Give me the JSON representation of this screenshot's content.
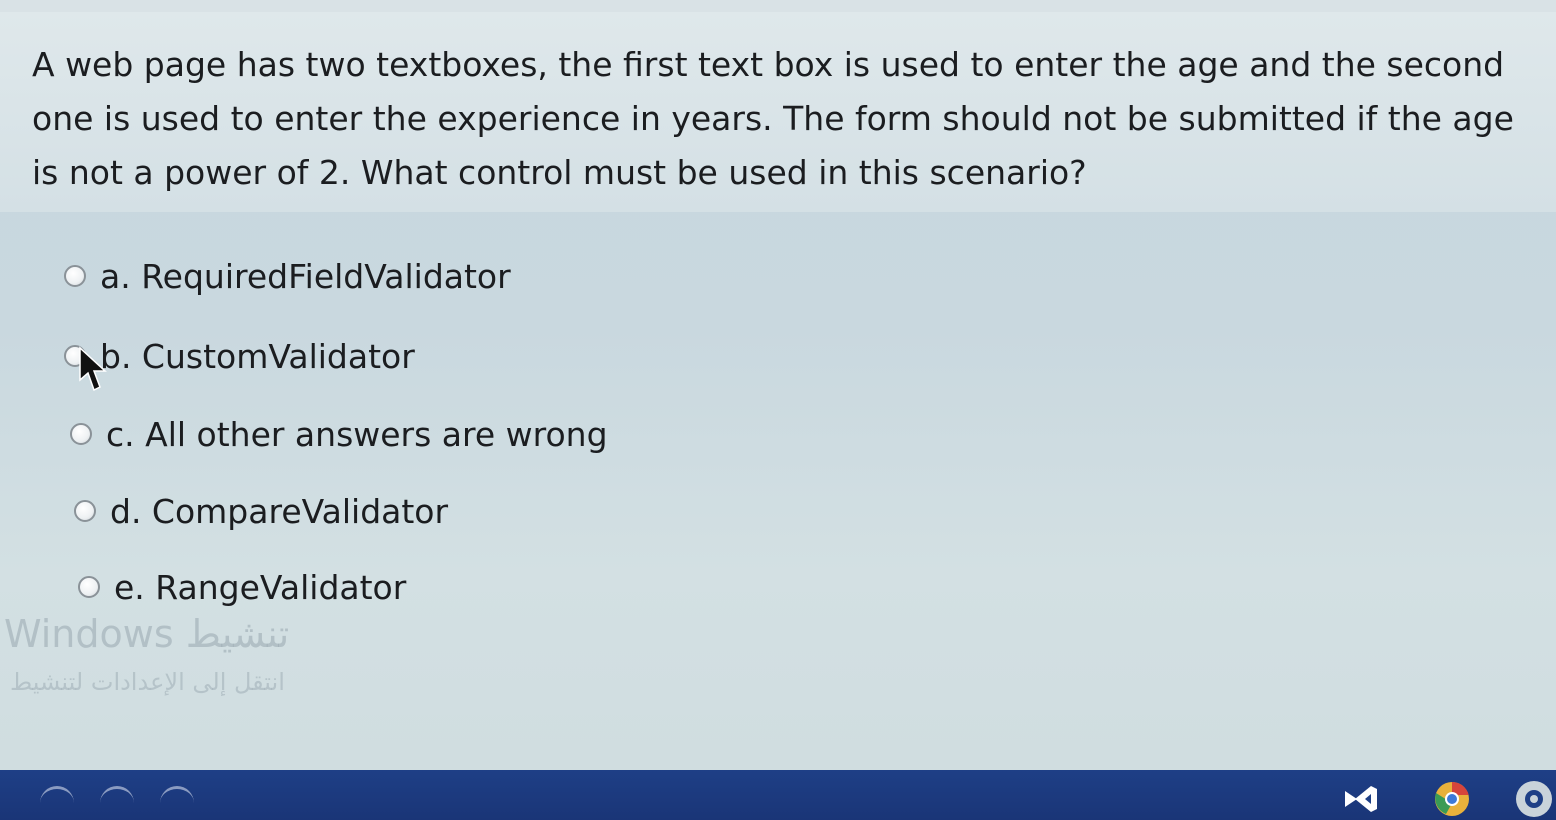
{
  "question": {
    "text": "A web page has two textboxes, the first text box is used to enter the age and the second one is used to enter the experience in years. The form should not be submitted if the age is not a power of 2. What control must be used in this scenario?"
  },
  "options": [
    {
      "label": "a. RequiredFieldValidator"
    },
    {
      "label": "b. CustomValidator"
    },
    {
      "label": "c. All other answers are wrong"
    },
    {
      "label": "d. CompareValidator"
    },
    {
      "label": "e. RangeValidator"
    }
  ],
  "watermark": {
    "line1": "Windows تنشيط",
    "line2": "انتقل إلى الإعدادات لتنشيط"
  },
  "taskbar": {
    "icons": [
      "visual-studio-icon",
      "chrome-icon",
      "app-icon"
    ]
  },
  "colors": {
    "taskbar": "#1e3f86",
    "text": "#1b1d20"
  }
}
